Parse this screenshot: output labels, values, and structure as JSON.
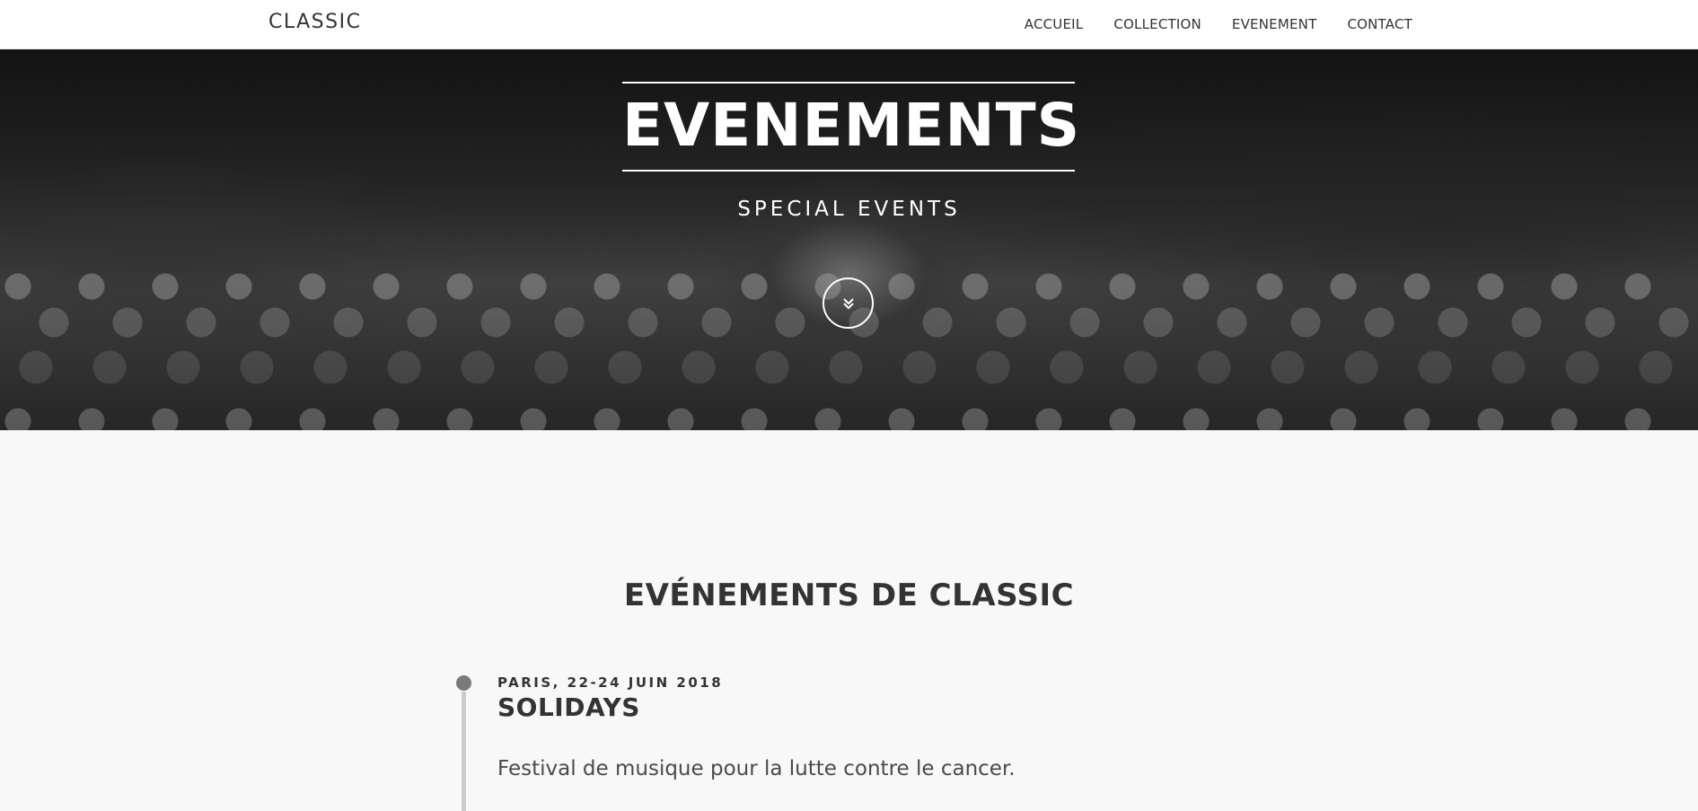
{
  "navbar": {
    "brand": "CLASSIC",
    "links": [
      "ACCUEIL",
      "COLLECTION",
      "EVENEMENT",
      "CONTACT"
    ]
  },
  "hero": {
    "title": "EVENEMENTS",
    "subtitle": "SPECIAL EVENTS",
    "scroll_icon": "double-chevron-down-icon"
  },
  "section": {
    "title": "EVÉNEMENTS DE CLASSIC"
  },
  "events": [
    {
      "date": "PARIS, 22-24 JUIN 2018",
      "name": "SOLIDAYS",
      "description": "Festival de musique pour la lutte contre le cancer."
    }
  ],
  "colors": {
    "text": "#333333",
    "background": "#f8f8f8",
    "navbar": "#ffffff",
    "timeline_line": "#c8ced3",
    "timeline_dot": "#7a7a7a"
  }
}
